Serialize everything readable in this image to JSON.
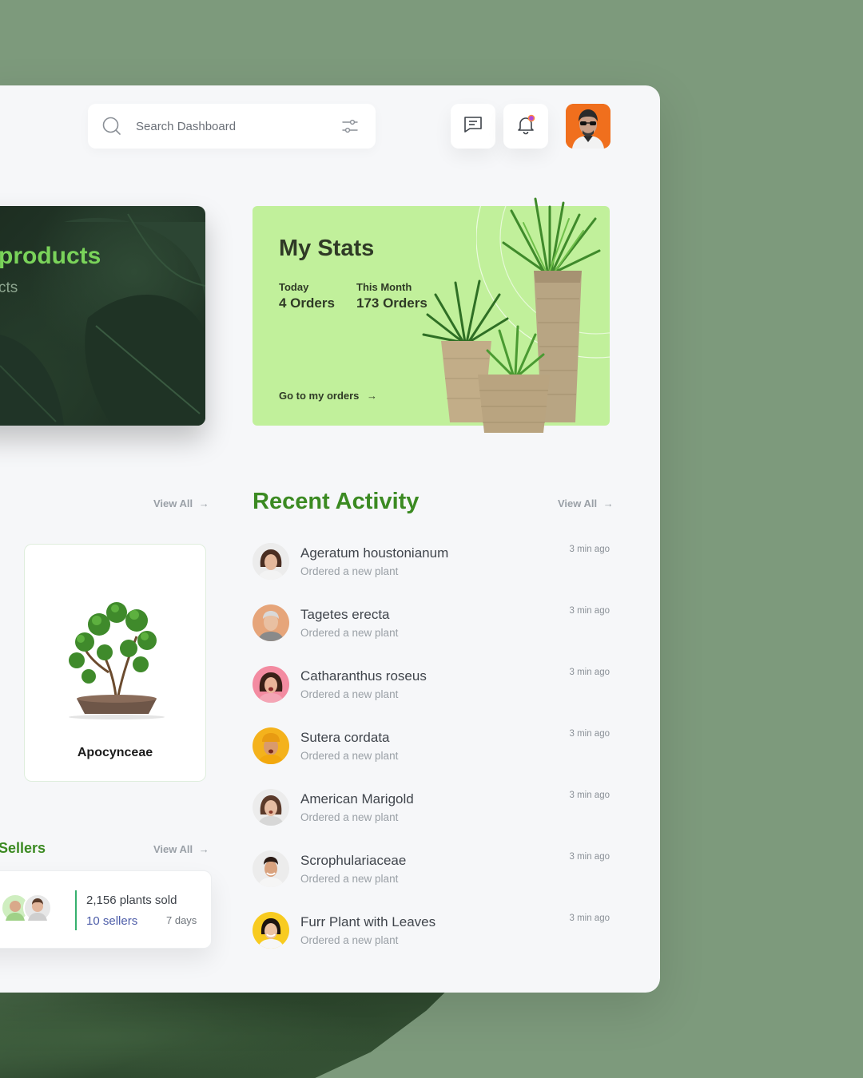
{
  "header": {
    "search_placeholder": "Search Dashboard",
    "icons": [
      "search-icon",
      "filter-icon",
      "message-icon",
      "bell-icon"
    ]
  },
  "banner": {
    "title": "products",
    "subtitle": "cts"
  },
  "stats": {
    "title": "My Stats",
    "today_label": "Today",
    "today_value": "4 Orders",
    "month_label": "This Month",
    "month_value": "173 Orders",
    "link": "Go to my orders",
    "link_arrow": "→",
    "accent": "#c1f09b"
  },
  "products": {
    "view_all": "View All",
    "card": {
      "name": "Apocynceae"
    }
  },
  "sellers": {
    "title": "Sellers",
    "view_all": "View All",
    "sold": "2,156 plants sold",
    "count": "10 sellers",
    "period": "7 days"
  },
  "recent_activity": {
    "title": "Recent Activity",
    "view_all": "View All",
    "items": [
      {
        "name": "Ageratum houstonianum",
        "desc": "Ordered a new plant",
        "time": "3 min ago",
        "color": "#ececec"
      },
      {
        "name": "Tagetes erecta",
        "desc": "Ordered a new plant",
        "time": "3 min ago",
        "color": "#e6a57a"
      },
      {
        "name": "Catharanthus roseus",
        "desc": "Ordered a new plant",
        "time": "3 min ago",
        "color": "#f38ba1"
      },
      {
        "name": "Sutera cordata",
        "desc": "Ordered a new plant",
        "time": "3 min ago",
        "color": "#f4b21c"
      },
      {
        "name": "American Marigold",
        "desc": "Ordered a new plant",
        "time": "3 min ago",
        "color": "#ececec"
      },
      {
        "name": "Scrophulariaceae",
        "desc": "Ordered a new plant",
        "time": "3 min ago",
        "color": "#ececec"
      },
      {
        "name": "Furr Plant with Leaves",
        "desc": "Ordered a new plant",
        "time": "3 min ago",
        "color": "#f8cb20"
      }
    ]
  },
  "colors": {
    "background": "#7d9a7c",
    "brand_green": "#3b8a22",
    "banner_green": "#7ad35a"
  }
}
